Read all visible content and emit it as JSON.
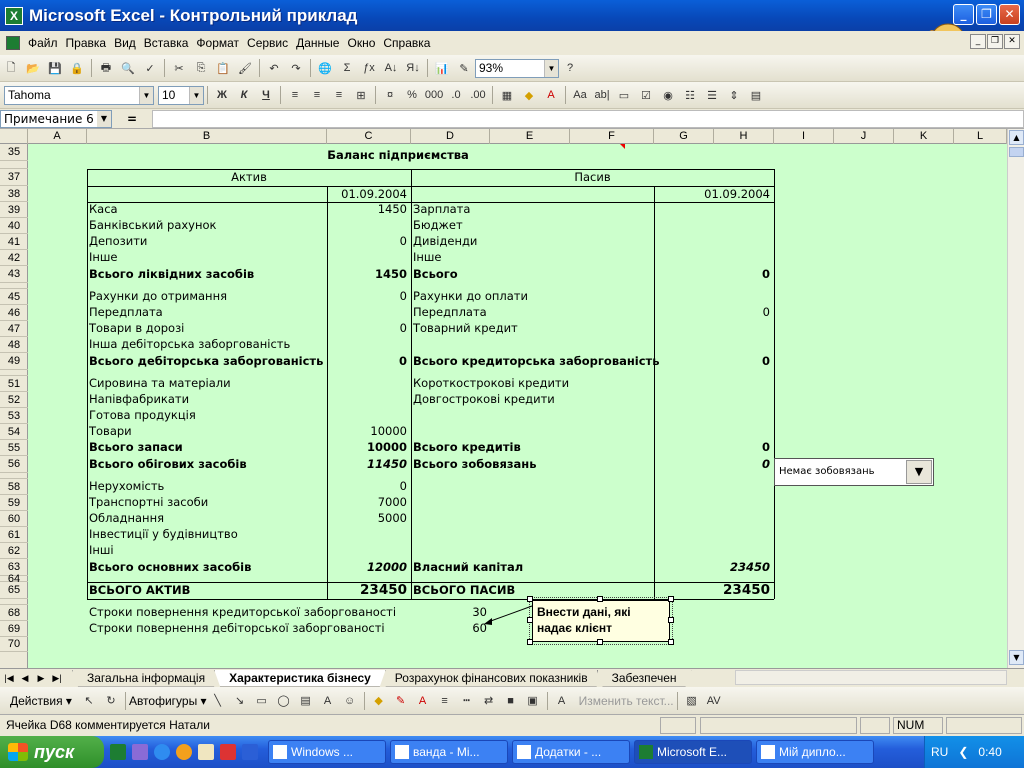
{
  "window": {
    "app_icon": "X",
    "title": "Microsoft Excel - Контрольний приклад",
    "btn_min": "_",
    "btn_max": "❐",
    "btn_close": "✕"
  },
  "menu": [
    "Файл",
    "Правка",
    "Вид",
    "Вставка",
    "Формат",
    "Сервис",
    "Данные",
    "Окно",
    "Справка"
  ],
  "toolbar": {
    "zoom": "93%",
    "font": "Tahoma",
    "size": "10",
    "bold": "Ж",
    "italic": "К",
    "underline": "Ч"
  },
  "formula": {
    "namebox": "Примечание 6",
    "eq": "=",
    "value": ""
  },
  "columns": [
    "A",
    "B",
    "C",
    "D",
    "E",
    "F",
    "G",
    "H",
    "I",
    "J",
    "K",
    "L"
  ],
  "rows": [
    "35",
    "",
    "37",
    "38",
    "39",
    "40",
    "41",
    "42",
    "43",
    "",
    "45",
    "46",
    "47",
    "48",
    "49",
    "",
    "51",
    "52",
    "53",
    "54",
    "55",
    "56",
    "",
    "58",
    "59",
    "60",
    "61",
    "62",
    "63",
    "64",
    "65",
    "",
    "68",
    "69",
    "70"
  ],
  "sheet": {
    "title": "Баланс підприємства",
    "asset_header": "Актив",
    "liab_header": "Пасив",
    "date_left": "01.09.2004",
    "date_right": "01.09.2004",
    "assets": [
      {
        "label": "Каса",
        "value": "1450",
        "b": false,
        "i": false
      },
      {
        "label": "Банківський рахунок",
        "value": "",
        "b": false,
        "i": false
      },
      {
        "label": "Депозити",
        "value": "0",
        "b": false,
        "i": false
      },
      {
        "label": "Інше",
        "value": "",
        "b": false,
        "i": false
      },
      {
        "label": "Всього ліквідних засобів",
        "value": "1450",
        "b": true,
        "i": false
      },
      {
        "label": "Рахунки до отримання",
        "value": "0",
        "b": false,
        "i": false
      },
      {
        "label": "Передплата",
        "value": "",
        "b": false,
        "i": false
      },
      {
        "label": "Товари в дорозі",
        "value": "0",
        "b": false,
        "i": false
      },
      {
        "label": "Інша дебіторська заборгованість",
        "value": "",
        "b": false,
        "i": false
      },
      {
        "label": "Всього дебіторська заборгованість",
        "value": "0",
        "b": true,
        "i": false
      },
      {
        "label": "Сировина та матеріали",
        "value": "",
        "b": false,
        "i": false
      },
      {
        "label": "Напівфабрикати",
        "value": "",
        "b": false,
        "i": false
      },
      {
        "label": "Готова продукція",
        "value": "",
        "b": false,
        "i": false
      },
      {
        "label": "Товари",
        "value": "10000",
        "b": false,
        "i": false
      },
      {
        "label": "Всього запаси",
        "value": "10000",
        "b": true,
        "i": false
      },
      {
        "label": "Всього обігових засобів",
        "value": "11450",
        "b": true,
        "i": true
      },
      {
        "label": "Нерухомість",
        "value": "0",
        "b": false,
        "i": false
      },
      {
        "label": "Транспортні засоби",
        "value": "7000",
        "b": false,
        "i": false
      },
      {
        "label": "Обладнання",
        "value": "5000",
        "b": false,
        "i": false
      },
      {
        "label": "Інвестиції у будівництво",
        "value": "",
        "b": false,
        "i": false
      },
      {
        "label": "Інші",
        "value": "",
        "b": false,
        "i": false
      },
      {
        "label": "Всього основних засобів",
        "value": "12000",
        "b": true,
        "i": true
      },
      {
        "label": "ВСЬОГО АКТИВ",
        "value": "23450",
        "b": true,
        "i": false
      }
    ],
    "liabilities": [
      {
        "label": "Зарплата",
        "value": "",
        "b": false,
        "i": false
      },
      {
        "label": "Бюджет",
        "value": "",
        "b": false,
        "i": false
      },
      {
        "label": "Дивіденди",
        "value": "",
        "b": false,
        "i": false
      },
      {
        "label": "Інше",
        "value": "",
        "b": false,
        "i": false
      },
      {
        "label": "Всього",
        "value": "0",
        "b": true,
        "i": false
      },
      {
        "label": "Рахунки до оплати",
        "value": "",
        "b": false,
        "i": false
      },
      {
        "label": "Передплата",
        "value": "0",
        "b": false,
        "i": false
      },
      {
        "label": "Товарний кредит",
        "value": "",
        "b": false,
        "i": false
      },
      {
        "label": "",
        "value": "",
        "b": false,
        "i": false
      },
      {
        "label": "Всього кредиторська заборгованість",
        "value": "0",
        "b": true,
        "i": false
      },
      {
        "label": "Короткострокові кредити",
        "value": "",
        "b": false,
        "i": false
      },
      {
        "label": "Довгострокові кредити",
        "value": "",
        "b": false,
        "i": false
      },
      {
        "label": "",
        "value": "",
        "b": false,
        "i": false
      },
      {
        "label": "",
        "value": "",
        "b": false,
        "i": false
      },
      {
        "label": "Всього кредитів",
        "value": "0",
        "b": true,
        "i": false
      },
      {
        "label": "Всього зобовязань",
        "value": "0",
        "b": true,
        "i": true
      },
      {
        "label": "",
        "value": "",
        "b": false,
        "i": false
      },
      {
        "label": "",
        "value": "",
        "b": false,
        "i": false
      },
      {
        "label": "",
        "value": "",
        "b": false,
        "i": false
      },
      {
        "label": "",
        "value": "",
        "b": false,
        "i": false
      },
      {
        "label": "",
        "value": "",
        "b": false,
        "i": false
      },
      {
        "label": "Власний капітал",
        "value": "23450",
        "b": true,
        "i": true
      },
      {
        "label": "ВСЬОГО ПАСИВ",
        "value": "23450",
        "b": true,
        "i": false
      }
    ],
    "terms": [
      {
        "label": "Строки повернення кредиторської заборгованості",
        "value": "30"
      },
      {
        "label": "Строки повернення дебіторської заборгованості",
        "value": "60"
      }
    ],
    "dropdown": "Немає зобовязань",
    "comment": "Внести дані, які надає клієнт"
  },
  "tabs": [
    "Загальна інформація",
    "Характеристика бізнесу",
    "Розрахунок фінансових показників",
    "Забезпечен"
  ],
  "drawbar": {
    "actions": "Действия ▾",
    "autoshapes": "Автофигуры ▾",
    "edit_text": "Изменить текст..."
  },
  "status": {
    "text": "Ячейка D68 комментируется Натали",
    "num": "NUM"
  },
  "taskbar": {
    "start": "пуск",
    "tasks": [
      "Windows ...",
      "ванда - Mi...",
      "Додатки - ...",
      "Microsoft E...",
      "Мій дипло..."
    ],
    "lang": "RU",
    "clock": "0:40"
  }
}
